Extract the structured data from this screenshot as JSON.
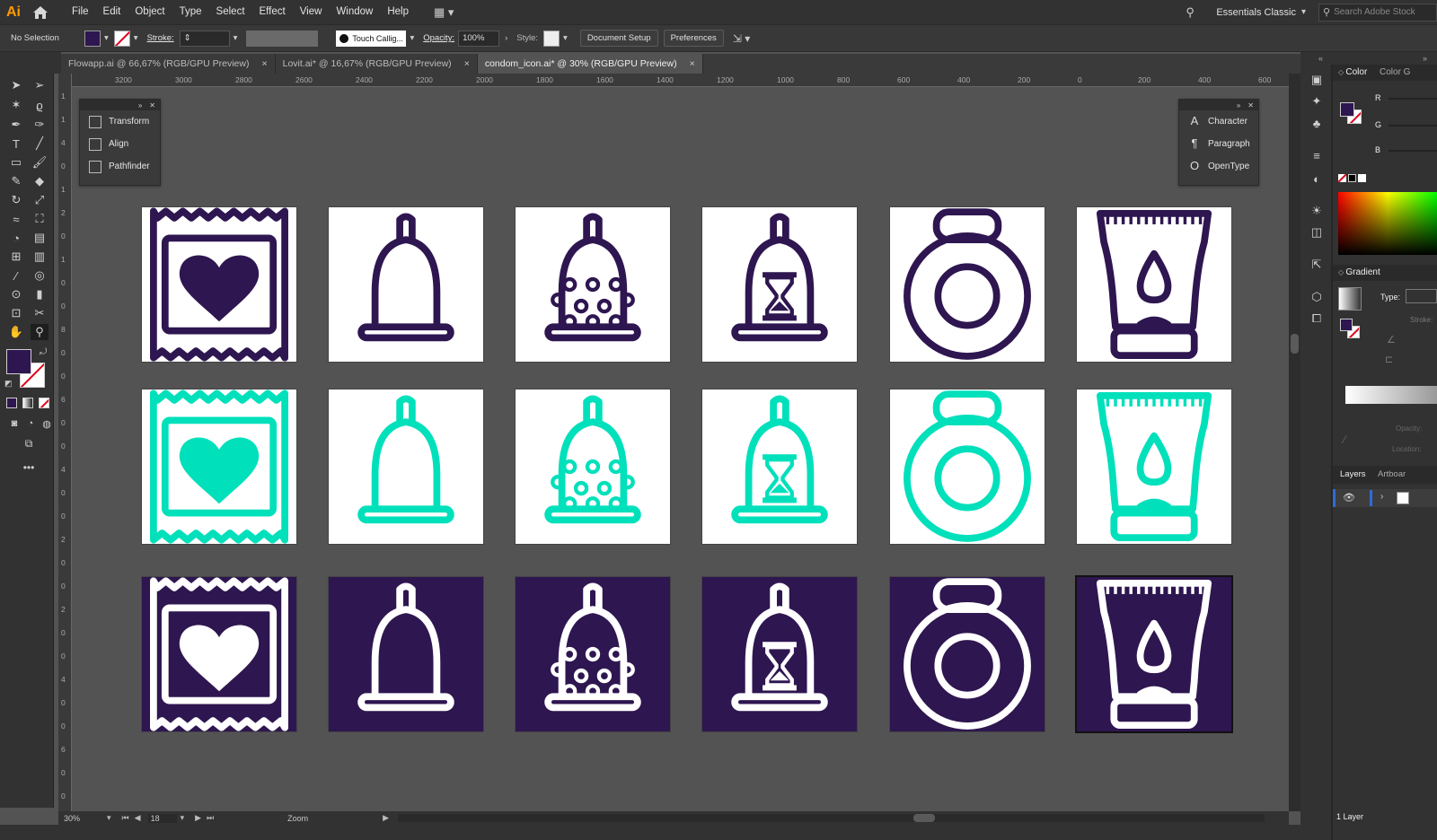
{
  "app": {
    "logo": "Ai"
  },
  "menu": [
    "File",
    "Edit",
    "Object",
    "Type",
    "Select",
    "Effect",
    "View",
    "Window",
    "Help"
  ],
  "workspace": {
    "name": "Essentials Classic",
    "search_placeholder": "Search Adobe Stock"
  },
  "control": {
    "selection": "No Selection",
    "stroke_label": "Stroke:",
    "brush": "Touch Callig...",
    "opacity_label": "Opacity:",
    "opacity": "100%",
    "style_label": "Style:",
    "doc_setup": "Document Setup",
    "preferences": "Preferences"
  },
  "tabs": [
    {
      "label": "Flowapp.ai @ 66,67% (RGB/GPU Preview)",
      "close": "×"
    },
    {
      "label": "Lovit.ai* @ 16,67% (RGB/GPU Preview)",
      "close": "×"
    },
    {
      "label": "condom_icon.ai* @ 30% (RGB/GPU Preview)",
      "close": "×"
    }
  ],
  "ruler_h": [
    "3200",
    "3000",
    "2800",
    "2600",
    "2400",
    "2200",
    "2000",
    "1800",
    "1600",
    "1400",
    "1200",
    "1000",
    "800",
    "600",
    "400",
    "200",
    "0",
    "200",
    "400",
    "600"
  ],
  "ruler_v": [
    "1",
    "1",
    "4",
    "0",
    "1",
    "2",
    "0",
    "1",
    "0",
    "0",
    "8",
    "0",
    "0",
    "6",
    "0",
    "0",
    "4",
    "0",
    "0",
    "2",
    "0",
    "0",
    "2",
    "0",
    "0",
    "4",
    "0",
    "0",
    "6",
    "0",
    "0"
  ],
  "left_panel": [
    {
      "icon": "transform-icon",
      "label": "Transform"
    },
    {
      "icon": "align-icon",
      "label": "Align"
    },
    {
      "icon": "pathfinder-icon",
      "label": "Pathfinder"
    }
  ],
  "right_float_panel": [
    {
      "icon": "character-icon",
      "label": "Character",
      "glyph": "A"
    },
    {
      "icon": "paragraph-icon",
      "label": "Paragraph",
      "glyph": "¶"
    },
    {
      "icon": "opentype-icon",
      "label": "OpenType",
      "glyph": "O"
    }
  ],
  "colors": {
    "purple": "#2e1650",
    "teal": "#00e0bb",
    "white": "#ffffff"
  },
  "icon_rows": [
    {
      "variant": "purple-outline",
      "bg": "#ffffff",
      "fg": "#2e1650"
    },
    {
      "variant": "teal-outline",
      "bg": "#ffffff",
      "fg": "#00e0bb"
    },
    {
      "variant": "white-on-purple",
      "bg": "#2e1650",
      "fg": "#ffffff"
    }
  ],
  "icon_types": [
    "condom-pack-icon",
    "condom-plain-icon",
    "condom-dotted-icon",
    "condom-hourglass-icon",
    "condom-ring-icon",
    "lube-tube-icon"
  ],
  "right_dock": {
    "color_tab": "Color",
    "color_guide_tab": "Color G",
    "r": "R",
    "g": "G",
    "b": "B",
    "gradient_tab": "Gradient",
    "type_label": "Type:",
    "stroke_label": "Stroke:",
    "opacity_label": "Opacity:",
    "location_label": "Location:",
    "layers_tab": "Layers",
    "artboards_tab": "Artboar",
    "layer_count": "1 Layer"
  },
  "status": {
    "zoom": "30%",
    "artboard": "18",
    "tool": "Zoom"
  }
}
